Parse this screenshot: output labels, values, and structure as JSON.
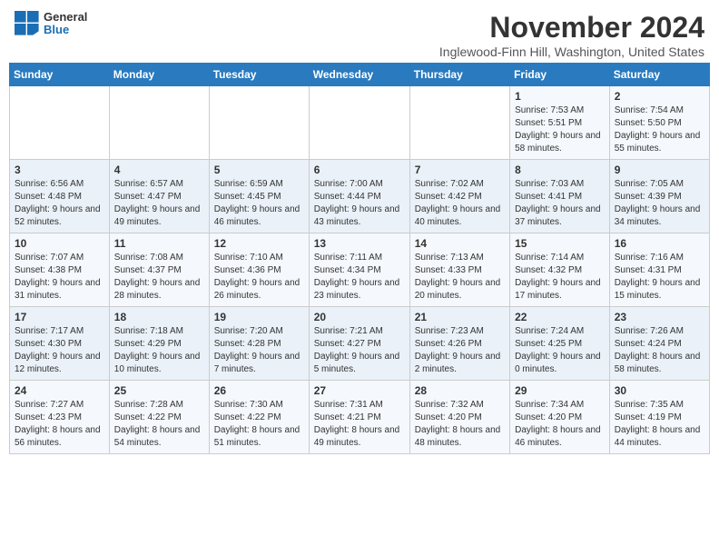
{
  "header": {
    "logo_general": "General",
    "logo_blue": "Blue",
    "month_title": "November 2024",
    "location": "Inglewood-Finn Hill, Washington, United States"
  },
  "days_of_week": [
    "Sunday",
    "Monday",
    "Tuesday",
    "Wednesday",
    "Thursday",
    "Friday",
    "Saturday"
  ],
  "weeks": [
    [
      {
        "day": "",
        "info": ""
      },
      {
        "day": "",
        "info": ""
      },
      {
        "day": "",
        "info": ""
      },
      {
        "day": "",
        "info": ""
      },
      {
        "day": "",
        "info": ""
      },
      {
        "day": "1",
        "info": "Sunrise: 7:53 AM\nSunset: 5:51 PM\nDaylight: 9 hours and 58 minutes."
      },
      {
        "day": "2",
        "info": "Sunrise: 7:54 AM\nSunset: 5:50 PM\nDaylight: 9 hours and 55 minutes."
      }
    ],
    [
      {
        "day": "3",
        "info": "Sunrise: 6:56 AM\nSunset: 4:48 PM\nDaylight: 9 hours and 52 minutes."
      },
      {
        "day": "4",
        "info": "Sunrise: 6:57 AM\nSunset: 4:47 PM\nDaylight: 9 hours and 49 minutes."
      },
      {
        "day": "5",
        "info": "Sunrise: 6:59 AM\nSunset: 4:45 PM\nDaylight: 9 hours and 46 minutes."
      },
      {
        "day": "6",
        "info": "Sunrise: 7:00 AM\nSunset: 4:44 PM\nDaylight: 9 hours and 43 minutes."
      },
      {
        "day": "7",
        "info": "Sunrise: 7:02 AM\nSunset: 4:42 PM\nDaylight: 9 hours and 40 minutes."
      },
      {
        "day": "8",
        "info": "Sunrise: 7:03 AM\nSunset: 4:41 PM\nDaylight: 9 hours and 37 minutes."
      },
      {
        "day": "9",
        "info": "Sunrise: 7:05 AM\nSunset: 4:39 PM\nDaylight: 9 hours and 34 minutes."
      }
    ],
    [
      {
        "day": "10",
        "info": "Sunrise: 7:07 AM\nSunset: 4:38 PM\nDaylight: 9 hours and 31 minutes."
      },
      {
        "day": "11",
        "info": "Sunrise: 7:08 AM\nSunset: 4:37 PM\nDaylight: 9 hours and 28 minutes."
      },
      {
        "day": "12",
        "info": "Sunrise: 7:10 AM\nSunset: 4:36 PM\nDaylight: 9 hours and 26 minutes."
      },
      {
        "day": "13",
        "info": "Sunrise: 7:11 AM\nSunset: 4:34 PM\nDaylight: 9 hours and 23 minutes."
      },
      {
        "day": "14",
        "info": "Sunrise: 7:13 AM\nSunset: 4:33 PM\nDaylight: 9 hours and 20 minutes."
      },
      {
        "day": "15",
        "info": "Sunrise: 7:14 AM\nSunset: 4:32 PM\nDaylight: 9 hours and 17 minutes."
      },
      {
        "day": "16",
        "info": "Sunrise: 7:16 AM\nSunset: 4:31 PM\nDaylight: 9 hours and 15 minutes."
      }
    ],
    [
      {
        "day": "17",
        "info": "Sunrise: 7:17 AM\nSunset: 4:30 PM\nDaylight: 9 hours and 12 minutes."
      },
      {
        "day": "18",
        "info": "Sunrise: 7:18 AM\nSunset: 4:29 PM\nDaylight: 9 hours and 10 minutes."
      },
      {
        "day": "19",
        "info": "Sunrise: 7:20 AM\nSunset: 4:28 PM\nDaylight: 9 hours and 7 minutes."
      },
      {
        "day": "20",
        "info": "Sunrise: 7:21 AM\nSunset: 4:27 PM\nDaylight: 9 hours and 5 minutes."
      },
      {
        "day": "21",
        "info": "Sunrise: 7:23 AM\nSunset: 4:26 PM\nDaylight: 9 hours and 2 minutes."
      },
      {
        "day": "22",
        "info": "Sunrise: 7:24 AM\nSunset: 4:25 PM\nDaylight: 9 hours and 0 minutes."
      },
      {
        "day": "23",
        "info": "Sunrise: 7:26 AM\nSunset: 4:24 PM\nDaylight: 8 hours and 58 minutes."
      }
    ],
    [
      {
        "day": "24",
        "info": "Sunrise: 7:27 AM\nSunset: 4:23 PM\nDaylight: 8 hours and 56 minutes."
      },
      {
        "day": "25",
        "info": "Sunrise: 7:28 AM\nSunset: 4:22 PM\nDaylight: 8 hours and 54 minutes."
      },
      {
        "day": "26",
        "info": "Sunrise: 7:30 AM\nSunset: 4:22 PM\nDaylight: 8 hours and 51 minutes."
      },
      {
        "day": "27",
        "info": "Sunrise: 7:31 AM\nSunset: 4:21 PM\nDaylight: 8 hours and 49 minutes."
      },
      {
        "day": "28",
        "info": "Sunrise: 7:32 AM\nSunset: 4:20 PM\nDaylight: 8 hours and 48 minutes."
      },
      {
        "day": "29",
        "info": "Sunrise: 7:34 AM\nSunset: 4:20 PM\nDaylight: 8 hours and 46 minutes."
      },
      {
        "day": "30",
        "info": "Sunrise: 7:35 AM\nSunset: 4:19 PM\nDaylight: 8 hours and 44 minutes."
      }
    ]
  ]
}
